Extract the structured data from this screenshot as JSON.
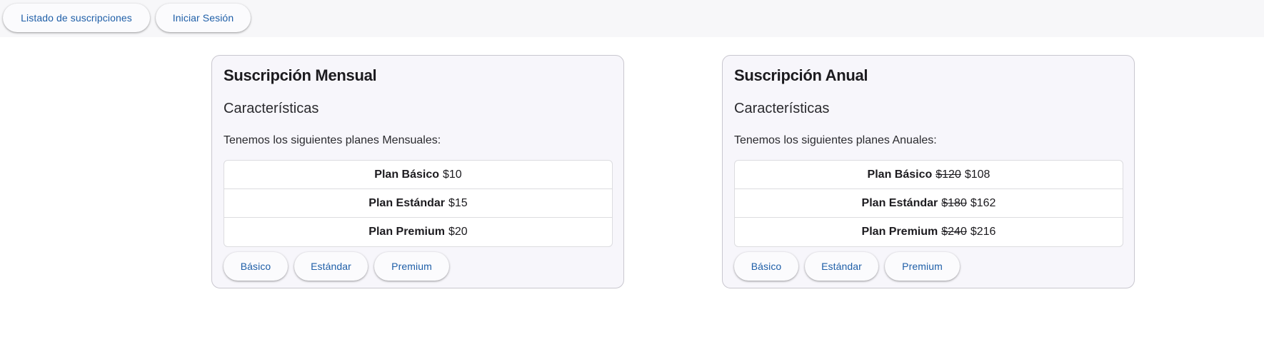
{
  "nav": {
    "list_label": "Listado de suscripciones",
    "login_label": "Iniciar Sesión"
  },
  "monthly": {
    "title": "Suscripción Mensual",
    "subtitle": "Características",
    "description": "Tenemos los siguientes planes Mensuales:",
    "plans": [
      {
        "name": "Plan Básico",
        "price": "$10"
      },
      {
        "name": "Plan Estándar",
        "price": "$15"
      },
      {
        "name": "Plan Premium",
        "price": "$20"
      }
    ],
    "buttons": [
      "Básico",
      "Estándar",
      "Premium"
    ]
  },
  "annual": {
    "title": "Suscripción Anual",
    "subtitle": "Características",
    "description": "Tenemos los siguientes planes Anuales:",
    "plans": [
      {
        "name": "Plan Básico",
        "old_price": "$120",
        "price": "$108"
      },
      {
        "name": "Plan Estándar",
        "old_price": "$180",
        "price": "$162"
      },
      {
        "name": "Plan Premium",
        "old_price": "$240",
        "price": "$216"
      }
    ],
    "buttons": [
      "Básico",
      "Estándar",
      "Premium"
    ]
  },
  "colors": {
    "accent": "#1f5fa8",
    "card_bg": "#f7f6fb",
    "topbar_bg": "#f7f7f9"
  }
}
